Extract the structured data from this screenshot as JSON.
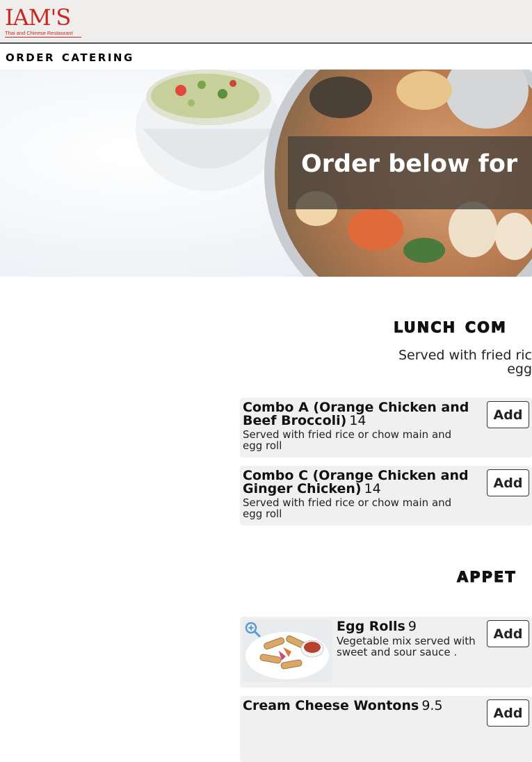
{
  "header": {
    "logo_main": "IAM'S",
    "logo_sub": "Thai and Chinese Restaurant"
  },
  "page_title": "Order Catering",
  "hero": {
    "text": "Order below for"
  },
  "sections": [
    {
      "title": "Lunch Com",
      "desc_line1": "Served with fried ric",
      "desc_line2": "egg",
      "items": [
        {
          "name": "Combo A (Orange Chicken and Beef Broccoli)",
          "price": "14",
          "desc": "Served with fried rice or chow main and egg roll",
          "button": "Add"
        },
        {
          "name": "Combo C (Orange Chicken and Ginger Chicken)",
          "price": "14",
          "desc": "Served with fried rice or chow main and egg roll",
          "button": "Add"
        }
      ]
    },
    {
      "title": "Appet",
      "items": [
        {
          "name": "Egg Rolls",
          "price": "9",
          "desc": "Vegetable mix served with sweet and sour sauce .",
          "button": "Add",
          "image": "egg-rolls-photo"
        },
        {
          "name": "Cream Cheese Wontons",
          "price": "9.5",
          "desc": "",
          "button": "Add"
        }
      ]
    }
  ],
  "colors": {
    "brand": "#c8281e",
    "topbar": "#efeeec",
    "card": "#f0f0f0",
    "zoom_icon": "#5b9bd5"
  }
}
